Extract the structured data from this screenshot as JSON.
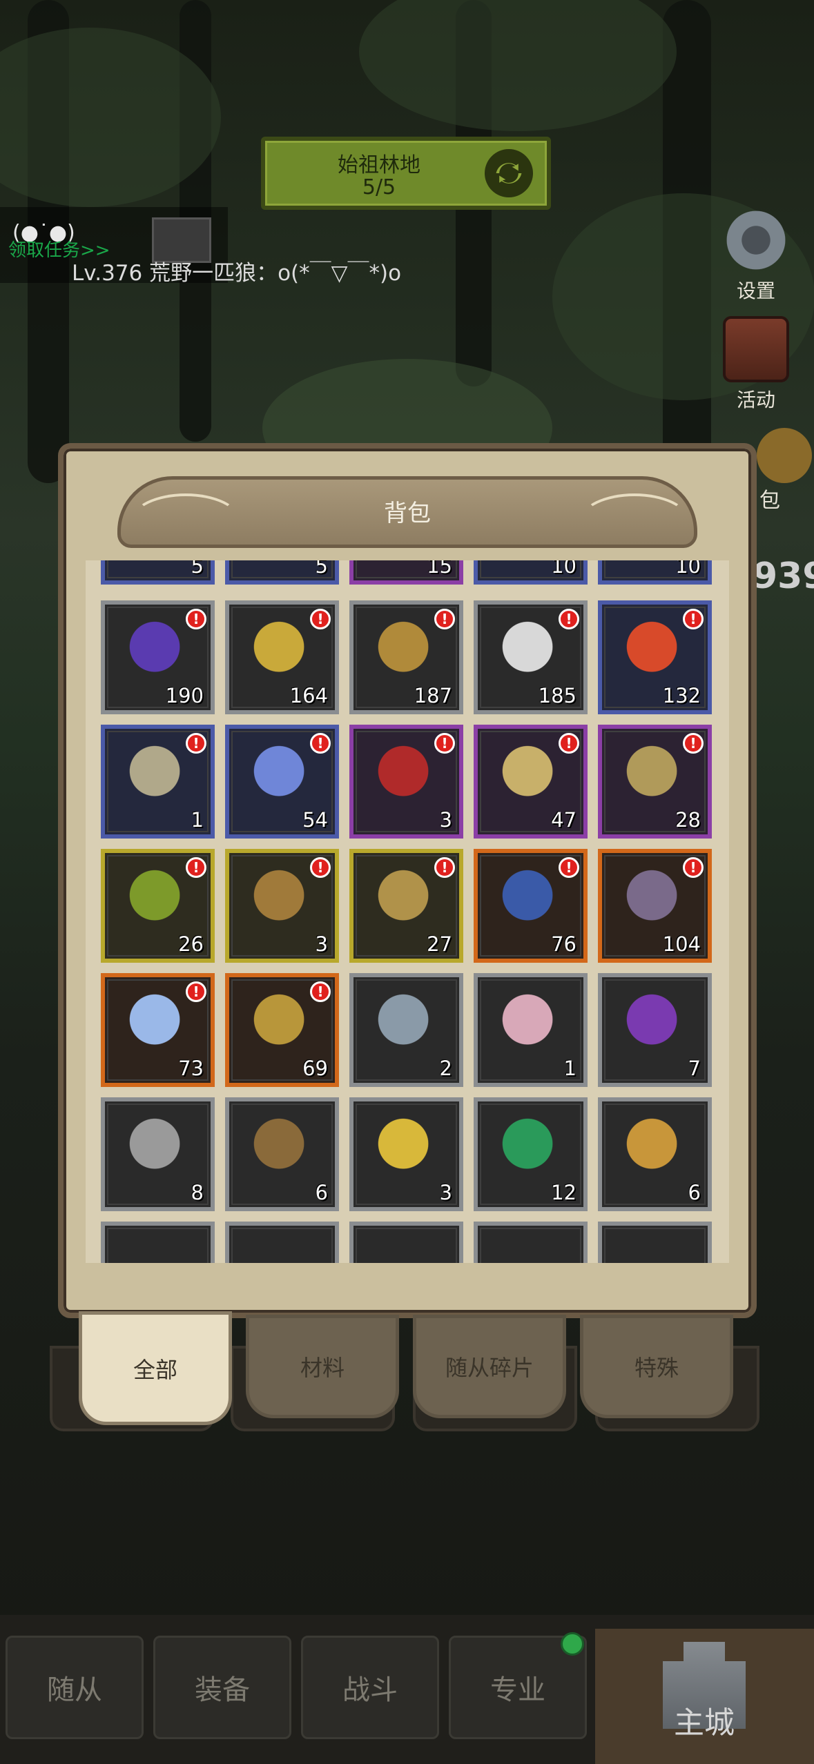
{
  "zone": {
    "name": "始祖林地",
    "progress": "5/5",
    "refresh_icon": "refresh-icon"
  },
  "chat": {
    "face": "(●˙●)",
    "quest_link": "领取任务>>",
    "message": "Lv.376 荒野一匹狼：o(*￣▽￣*)o"
  },
  "side_menu": {
    "settings": "设置",
    "activity": "活动",
    "bag": "包"
  },
  "background_number": "939",
  "bag": {
    "title": "背包",
    "partial_top_row": [
      "5",
      "5",
      "15",
      "10",
      "10"
    ],
    "partial_top_rarity": [
      "blue",
      "blue",
      "purple",
      "blue",
      "blue"
    ],
    "rows": [
      [
        {
          "icon": "purple-cloak-icon",
          "count": "190",
          "rarity": "grey",
          "alert": true
        },
        {
          "icon": "jade-ring-icon",
          "count": "164",
          "rarity": "grey",
          "alert": true
        },
        {
          "icon": "gauntlet-icon",
          "count": "187",
          "rarity": "grey",
          "alert": true
        },
        {
          "icon": "claw-icon",
          "count": "185",
          "rarity": "grey",
          "alert": true
        },
        {
          "icon": "red-amulet-icon",
          "count": "132",
          "rarity": "blue",
          "alert": true
        }
      ],
      [
        {
          "icon": "horn-ring-icon",
          "count": "1",
          "rarity": "blue",
          "alert": true
        },
        {
          "icon": "lightning-orb-icon",
          "count": "54",
          "rarity": "blue",
          "alert": true
        },
        {
          "icon": "red-hood-icon",
          "count": "3",
          "rarity": "purple",
          "alert": true
        },
        {
          "icon": "striped-horn-icon",
          "count": "47",
          "rarity": "purple",
          "alert": true
        },
        {
          "icon": "rune-bracer-icon",
          "count": "28",
          "rarity": "purple",
          "alert": true
        }
      ],
      [
        {
          "icon": "flame-hood-icon",
          "count": "26",
          "rarity": "yellow",
          "alert": true
        },
        {
          "icon": "pipe-icon",
          "count": "3",
          "rarity": "yellow",
          "alert": true
        },
        {
          "icon": "jeweled-crown-icon",
          "count": "27",
          "rarity": "yellow",
          "alert": true
        },
        {
          "icon": "horned-helmet-icon",
          "count": "76",
          "rarity": "orange",
          "alert": true
        },
        {
          "icon": "dagger-icon",
          "count": "104",
          "rarity": "orange",
          "alert": true
        }
      ],
      [
        {
          "icon": "ice-orb-icon",
          "count": "73",
          "rarity": "orange",
          "alert": true
        },
        {
          "icon": "gold-crown-icon",
          "count": "69",
          "rarity": "orange",
          "alert": true
        },
        {
          "icon": "hammer-icon",
          "count": "2",
          "rarity": "grey",
          "alert": false
        },
        {
          "icon": "crystal-mask-icon",
          "count": "1",
          "rarity": "grey",
          "alert": false
        },
        {
          "icon": "shuriken-icon",
          "count": "7",
          "rarity": "grey",
          "alert": false
        }
      ],
      [
        {
          "icon": "stone-shield-icon",
          "count": "8",
          "rarity": "grey",
          "alert": false
        },
        {
          "icon": "crest-shield-icon",
          "count": "6",
          "rarity": "grey",
          "alert": false
        },
        {
          "icon": "winged-emblem-icon",
          "count": "3",
          "rarity": "grey",
          "alert": false
        },
        {
          "icon": "emerald-badge-icon",
          "count": "12",
          "rarity": "grey",
          "alert": false
        },
        {
          "icon": "lion-shield-icon",
          "count": "6",
          "rarity": "grey",
          "alert": false
        }
      ]
    ],
    "partial_bottom_row": [
      "",
      "",
      "",
      "",
      ""
    ],
    "alert_mark": "!"
  },
  "category_tabs": [
    "全部",
    "材料",
    "随从碎片",
    "特殊"
  ],
  "active_category": "全部",
  "bottom_nav": [
    "随从",
    "装备",
    "战斗",
    "专业"
  ],
  "main_city": "主城",
  "colors": {
    "grey": "#8a8d90",
    "blue": "#4b5aa8",
    "purple": "#8b3fa6",
    "yellow": "#b8a82c",
    "orange": "#d2681a",
    "alert": "#e0211e"
  }
}
